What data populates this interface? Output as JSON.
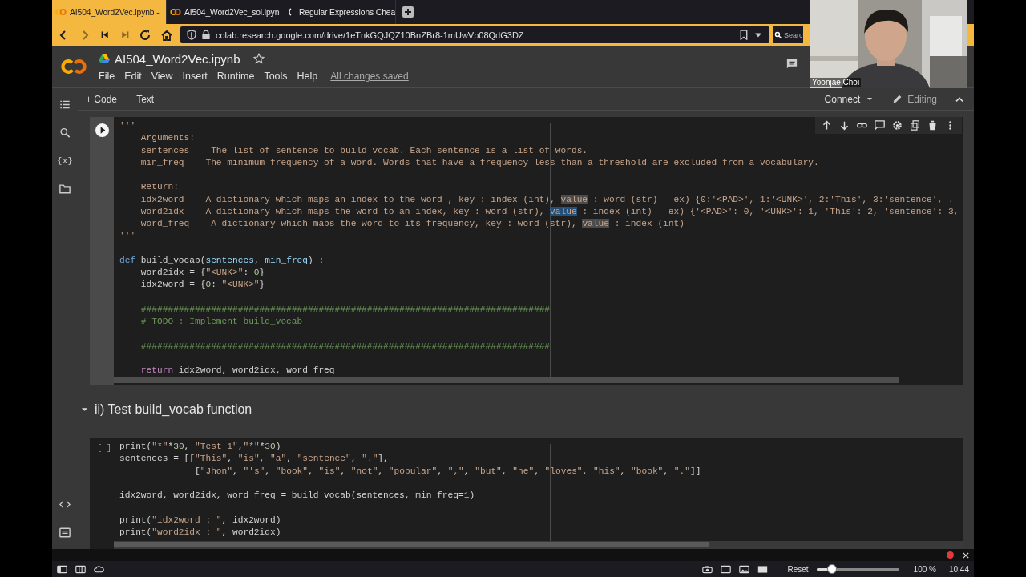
{
  "browser": {
    "tabs": [
      {
        "title": "AI504_Word2Vec.ipynb -",
        "selected": true
      },
      {
        "title": "AI504_Word2Vec_sol.ipyn",
        "selected": false
      },
      {
        "title": "Regular Expressions Chea",
        "selected": false
      }
    ],
    "url": "colab.research.google.com/drive/1eTnkGQJQZ10BnZBr8-1mUwVp08QdG3DZ",
    "search": {
      "placeholder": "Searc"
    }
  },
  "webcam": {
    "name": "Yoonjae Choi"
  },
  "header": {
    "title": "AI504_Word2Vec.ipynb",
    "menu": [
      "File",
      "Edit",
      "View",
      "Insert",
      "Runtime",
      "Tools",
      "Help"
    ],
    "save_status": "All changes saved"
  },
  "sidebar": {
    "variables_label": "{x}"
  },
  "toolbar": {
    "add": [
      "+ Code",
      "+ Text"
    ],
    "connect": "Connect",
    "mode": "Editing"
  },
  "cells": [
    {
      "kind": "code",
      "focused": true,
      "blocks": [
        [
          [
            {
              "kind": "string",
              "text": "'''"
            }
          ],
          [
            {
              "kind": "string",
              "text": "    Arguments:"
            }
          ],
          [
            {
              "kind": "string",
              "text": "    sentences -- The list of sentence to build vocab. Each sentence is a list of words."
            }
          ],
          [
            {
              "kind": "string",
              "text": "    min_freq -- The minimum frequency of a word. Words that have a frequency less than a threshold are excluded from a vocabulary."
            }
          ]
        ],
        [
          [
            {
              "kind": "string",
              "text": "    Return:"
            }
          ],
          [
            {
              "kind": "string",
              "text": "    idx2word -- A dictionary which maps an index to the word , key : index (int), "
            },
            {
              "kind": "match",
              "text": "value"
            },
            {
              "kind": "string",
              "text": " : word (str)   ex) {0:'<PAD>', 1:'<UNK>', 2:'This', 3:'sentence', ."
            }
          ],
          [
            {
              "kind": "string",
              "text": "    word2idx -- A dictionary which maps the word to an index, key : word (str), "
            },
            {
              "kind": "selection",
              "text": "value"
            },
            {
              "kind": "string",
              "text": " : index (int)   ex) {'<PAD>': 0, '<UNK>': 1, 'This': 2, 'sentence': 3,"
            }
          ],
          [
            {
              "kind": "string",
              "text": "    word_freq -- A dictionary which maps the word to its frequency, key : word (str), "
            },
            {
              "kind": "match",
              "text": "value"
            },
            {
              "kind": "string",
              "text": " : index (int)"
            }
          ],
          [
            {
              "kind": "string",
              "text": "'''"
            }
          ]
        ],
        [
          [
            {
              "kind": "keyword",
              "text": "def"
            },
            {
              "kind": "plain",
              "text": " build_vocab("
            },
            {
              "kind": "param",
              "text": "sentences"
            },
            {
              "kind": "plain",
              "text": ", "
            },
            {
              "kind": "param",
              "text": "min_freq"
            },
            {
              "kind": "plain",
              "text": ") :"
            }
          ],
          [
            {
              "kind": "plain",
              "text": "    word2idx = {"
            },
            {
              "kind": "string",
              "text": "\"<UNK>\""
            },
            {
              "kind": "plain",
              "text": ": "
            },
            {
              "kind": "number",
              "text": "0"
            },
            {
              "kind": "plain",
              "text": "}"
            }
          ],
          [
            {
              "kind": "plain",
              "text": "    idx2word = {"
            },
            {
              "kind": "number",
              "text": "0"
            },
            {
              "kind": "plain",
              "text": ": "
            },
            {
              "kind": "string",
              "text": "\"<UNK>\""
            },
            {
              "kind": "plain",
              "text": "}"
            }
          ]
        ],
        [
          [
            {
              "kind": "comment",
              "text": "    ############################################################################"
            }
          ],
          [
            {
              "kind": "comment",
              "text": "    # TODO : Implement build_vocab"
            }
          ]
        ],
        [
          [
            {
              "kind": "comment",
              "text": "    ############################################################################"
            }
          ]
        ],
        [
          [
            {
              "kind": "control",
              "text": "    return"
            },
            {
              "kind": "plain",
              "text": " idx2word, word2idx, word_freq"
            }
          ]
        ]
      ]
    },
    {
      "kind": "heading",
      "text": "ii) Test build_vocab function",
      "expanded": true
    },
    {
      "kind": "code",
      "focused": false,
      "prompt": "[ ]",
      "blocks": [
        [
          [
            {
              "kind": "plain",
              "text": "print("
            },
            {
              "kind": "string",
              "text": "\"*\""
            },
            {
              "kind": "plain",
              "text": "*"
            },
            {
              "kind": "number",
              "text": "30"
            },
            {
              "kind": "plain",
              "text": ", "
            },
            {
              "kind": "string",
              "text": "\"Test 1\""
            },
            {
              "kind": "plain",
              "text": ","
            },
            {
              "kind": "string",
              "text": "\"*\""
            },
            {
              "kind": "plain",
              "text": "*"
            },
            {
              "kind": "number",
              "text": "30"
            },
            {
              "kind": "plain",
              "text": ")"
            }
          ],
          [
            {
              "kind": "plain",
              "text": "sentences = [["
            },
            {
              "kind": "string",
              "text": "\"This\""
            },
            {
              "kind": "plain",
              "text": ", "
            },
            {
              "kind": "string",
              "text": "\"is\""
            },
            {
              "kind": "plain",
              "text": ", "
            },
            {
              "kind": "string",
              "text": "\"a\""
            },
            {
              "kind": "plain",
              "text": ", "
            },
            {
              "kind": "string",
              "text": "\"sentence\""
            },
            {
              "kind": "plain",
              "text": ", "
            },
            {
              "kind": "string",
              "text": "\".\""
            },
            {
              "kind": "plain",
              "text": "],"
            }
          ],
          [
            {
              "kind": "plain",
              "text": "              ["
            },
            {
              "kind": "string",
              "text": "\"Jhon\""
            },
            {
              "kind": "plain",
              "text": ", "
            },
            {
              "kind": "string",
              "text": "\"'s\""
            },
            {
              "kind": "plain",
              "text": ", "
            },
            {
              "kind": "string",
              "text": "\"book\""
            },
            {
              "kind": "plain",
              "text": ", "
            },
            {
              "kind": "string",
              "text": "\"is\""
            },
            {
              "kind": "plain",
              "text": ", "
            },
            {
              "kind": "string",
              "text": "\"not\""
            },
            {
              "kind": "plain",
              "text": ", "
            },
            {
              "kind": "string",
              "text": "\"popular\""
            },
            {
              "kind": "plain",
              "text": ", "
            },
            {
              "kind": "string",
              "text": "\",\""
            },
            {
              "kind": "plain",
              "text": ", "
            },
            {
              "kind": "string",
              "text": "\"but\""
            },
            {
              "kind": "plain",
              "text": ", "
            },
            {
              "kind": "string",
              "text": "\"he\""
            },
            {
              "kind": "plain",
              "text": ", "
            },
            {
              "kind": "string",
              "text": "\"loves\""
            },
            {
              "kind": "plain",
              "text": ", "
            },
            {
              "kind": "string",
              "text": "\"his\""
            },
            {
              "kind": "plain",
              "text": ", "
            },
            {
              "kind": "string",
              "text": "\"book\""
            },
            {
              "kind": "plain",
              "text": ", "
            },
            {
              "kind": "string",
              "text": "\".\""
            },
            {
              "kind": "plain",
              "text": "]]"
            }
          ]
        ],
        [
          [
            {
              "kind": "plain",
              "text": "idx2word, word2idx, word_freq = build_vocab(sentences, min_freq="
            },
            {
              "kind": "number",
              "text": "1"
            },
            {
              "kind": "plain",
              "text": ")"
            }
          ]
        ],
        [
          [
            {
              "kind": "plain",
              "text": "print("
            },
            {
              "kind": "string",
              "text": "\"idx2word : \""
            },
            {
              "kind": "plain",
              "text": ", idx2word)"
            }
          ],
          [
            {
              "kind": "plain",
              "text": "print("
            },
            {
              "kind": "string",
              "text": "\"word2idx : \""
            },
            {
              "kind": "plain",
              "text": ", word2idx)"
            }
          ]
        ]
      ]
    }
  ],
  "status_bar": {
    "reset": "Reset",
    "zoom": {
      "level": 0.19
    },
    "zoom_reading": "100 %",
    "time": "10:44"
  }
}
